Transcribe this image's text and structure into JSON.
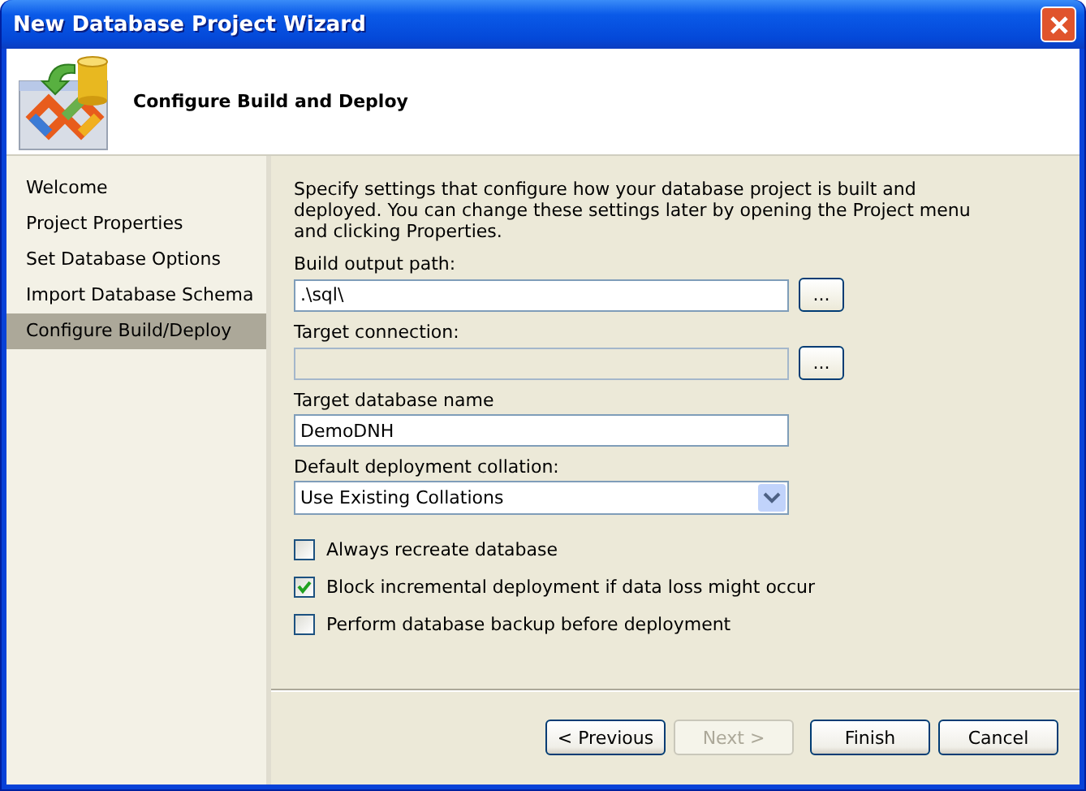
{
  "window": {
    "title": "New Database Project Wizard"
  },
  "header": {
    "title": "Configure Build and Deploy"
  },
  "steps": [
    {
      "label": "Welcome",
      "selected": false
    },
    {
      "label": "Project Properties",
      "selected": false
    },
    {
      "label": "Set Database Options",
      "selected": false
    },
    {
      "label": "Import Database Schema",
      "selected": false
    },
    {
      "label": "Configure Build/Deploy",
      "selected": true
    }
  ],
  "description": "Specify settings that configure how your database project is built and deployed. You can change these settings later by opening the Project menu and clicking Properties.",
  "fields": [
    {
      "kind": "text",
      "label": "Build output path:",
      "value": ".\\sql\\",
      "disabled": false,
      "browse": "..."
    },
    {
      "kind": "text",
      "label": "Target connection:",
      "disabled": true,
      "browse": "..."
    },
    {
      "kind": "text",
      "label": "Target database name",
      "value": "DemoDNH",
      "disabled": false
    },
    {
      "kind": "select",
      "label": "Default deployment collation:",
      "value": "Use Existing Collations",
      "disabled": false
    }
  ],
  "checkboxes": [
    {
      "label": "Always recreate database",
      "checked": false
    },
    {
      "label": "Block incremental deployment if data loss might occur",
      "checked": true
    },
    {
      "label": "Perform database backup before deployment",
      "checked": false
    }
  ],
  "buttons": [
    {
      "label": "< Previous",
      "disabled": false
    },
    {
      "label": "Next >",
      "disabled": true
    },
    {
      "label": "Finish",
      "disabled": false
    },
    {
      "label": "Cancel",
      "disabled": false
    }
  ]
}
